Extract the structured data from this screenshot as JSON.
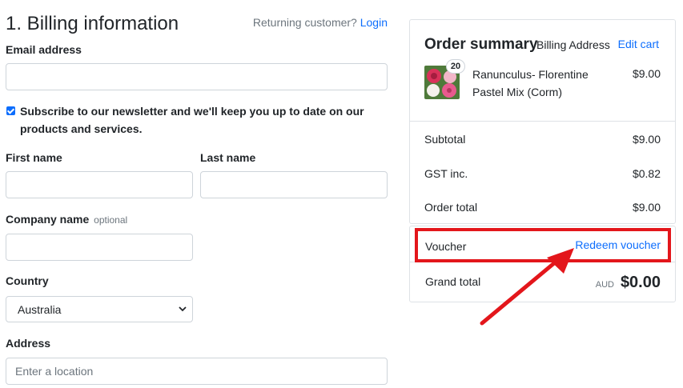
{
  "billing": {
    "title": "1. Billing information",
    "returning_text": "Returning customer?",
    "login_link": "Login",
    "email": {
      "label": "Email address",
      "value": "",
      "placeholder": ""
    },
    "newsletter": {
      "checked": true,
      "text": "Subscribe to our newsletter and we'll keep you up to date on our products and services."
    },
    "first_name": {
      "label": "First name",
      "value": ""
    },
    "last_name": {
      "label": "Last name",
      "value": ""
    },
    "company": {
      "label": "Company name",
      "optional": "optional",
      "value": ""
    },
    "country": {
      "label": "Country",
      "selected": "Australia"
    },
    "address": {
      "label": "Address",
      "placeholder": "Enter a location"
    }
  },
  "summary": {
    "title": "Order summary",
    "subtitle": "Billing Address",
    "edit_cart": "Edit cart",
    "item": {
      "name": "Ranunculus- Florentine Pastel Mix (Corm)",
      "price": "$9.00",
      "quantity": "20"
    },
    "subtotal": {
      "label": "Subtotal",
      "value": "$9.00"
    },
    "gst": {
      "label": "GST inc.",
      "value": "$0.82"
    },
    "order_total": {
      "label": "Order total",
      "value": "$9.00"
    }
  },
  "voucher": {
    "label": "Voucher",
    "redeem_link": "Redeem voucher",
    "grand_total_label": "Grand total",
    "currency": "AUD",
    "grand_total_value": "$0.00"
  },
  "colors": {
    "link": "#0d6efd",
    "highlight": "#e3161b",
    "border": "#dee2e6"
  },
  "icons": {
    "country_select": "chevron-down-icon",
    "annotation": "red-arrow-icon"
  }
}
